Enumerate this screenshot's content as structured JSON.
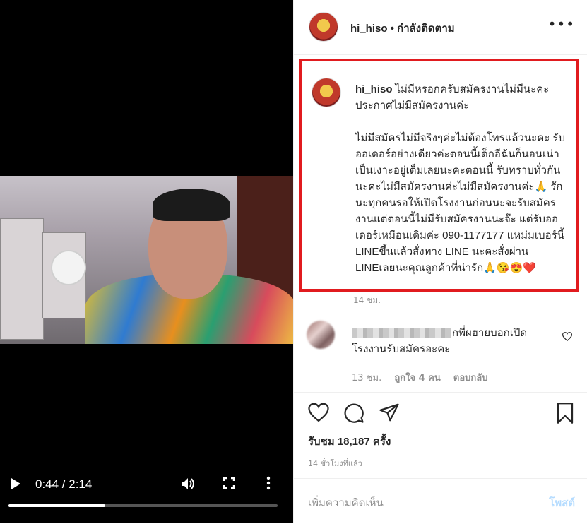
{
  "video": {
    "time_label": "0:44 / 2:14",
    "progress_fraction": 0.36
  },
  "header": {
    "username": "hi_hiso",
    "status": "• กำลังติดตาม"
  },
  "caption": {
    "username": "hi_hiso",
    "text": "ไม่มีหรอกครับสมัครงานไม่มีนะคะ ประกาศไม่มีสมัครงานค่ะ\n\nไม่มีสมัครไม่มีจริงๆค่ะไม่ต้องโทรแล้วนะคะ รับออเดอร์อย่างเดียวค่ะตอนนี้เด็กอีฉันก็นอนเน่าเป็นเงาะอยู่เต็มเลยนะคะตอนนี้ รับทราบทั่วกันนะคะไม่มีสมัครงานค่ะไม่มีสมัครงานค่ะ🙏 รักนะทุกคนรอให้เปิดโรงงานก่อนนะจะรับสมัครงานแต่ตอนนี้ไม่มีรับสมัครงานนะจ๊ะ แต่รับออเดอร์เหมือนเดิมค่ะ 090-1177177 แหม่มเบอร์นี้ LINEขึ้นแล้วสั่งทาง LINE นะคะสั่งผ่าน LINEเลยนะคุณลูกค้าที่น่ารัก🙏😘😍❤️",
    "time": "14 ชม."
  },
  "comment": {
    "text": "กพี่ผฮายบอกเปิด โรงงานรับสมัครอะคะ",
    "time": "13 ชม.",
    "likes": "ถูกใจ 4 คน",
    "reply": "ตอบกลับ"
  },
  "actions": {
    "views": "รับชม 18,187 ครั้ง",
    "ago": "14 ชั่วโมงที่แล้ว"
  },
  "add_comment": {
    "placeholder": "เพิ่มความคิดเห็น",
    "post_label": "โพสต์"
  },
  "colors": {
    "highlight": "#e11b1f",
    "post_button": "#b3dbff",
    "muted": "#8e8e8e"
  }
}
